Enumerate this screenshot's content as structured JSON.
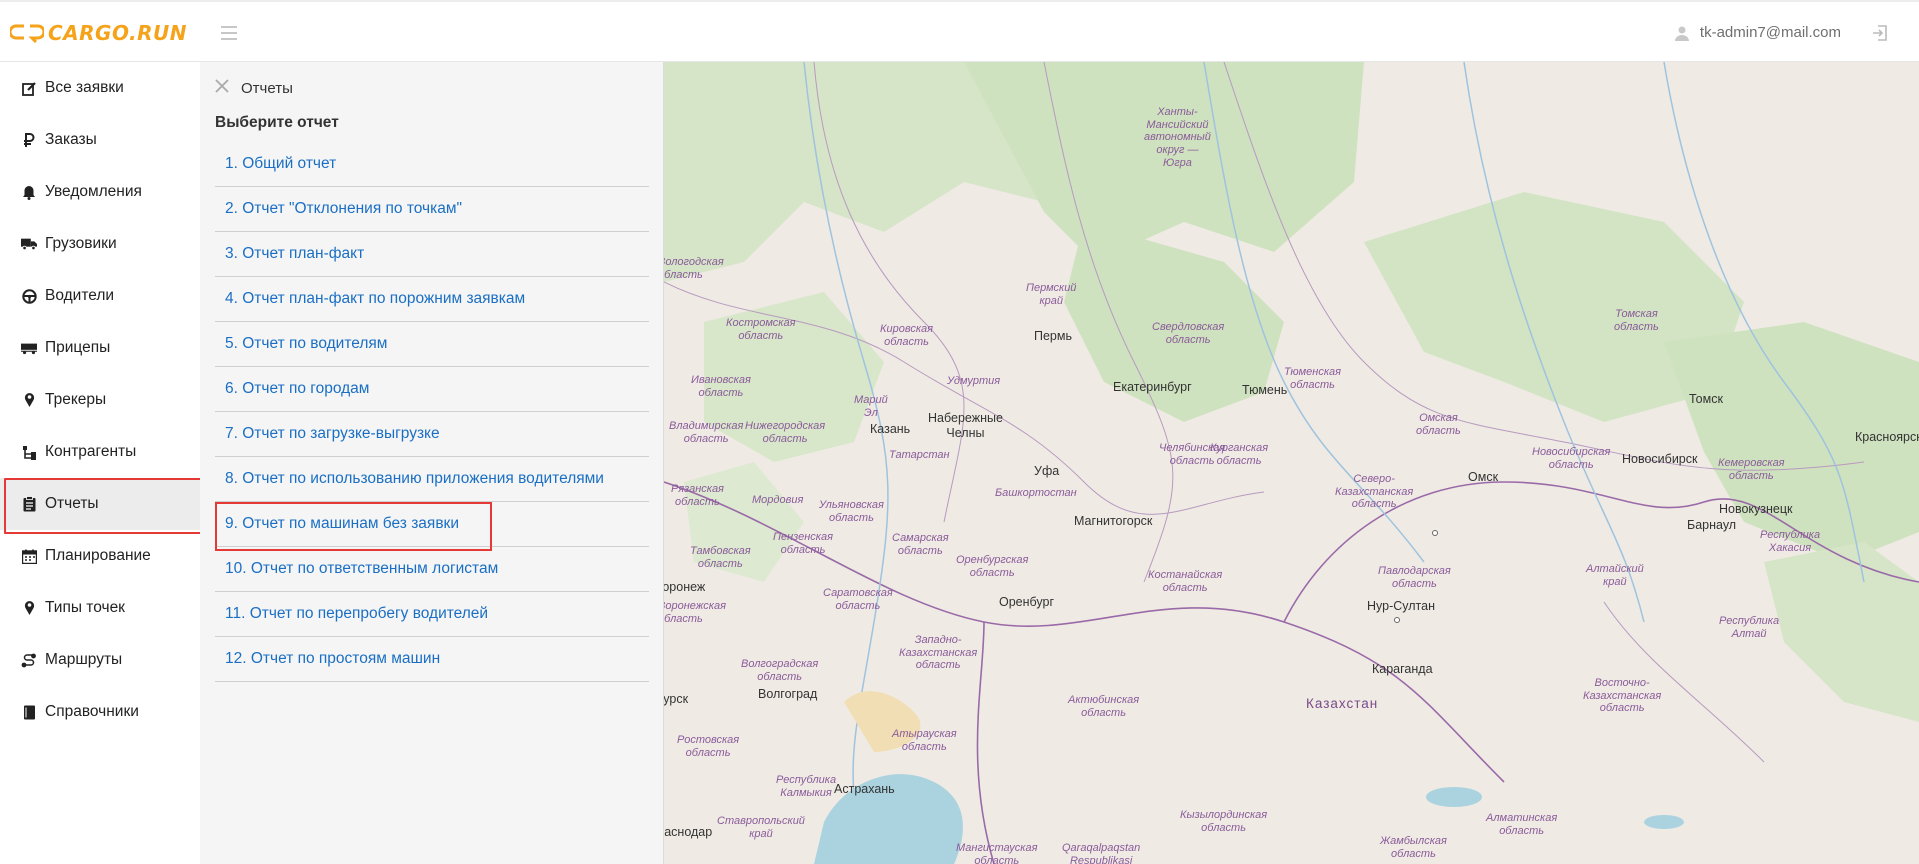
{
  "header": {
    "logo_text": "CARGO.RUN",
    "user_email": "tk-admin7@mail.com",
    "icons": {
      "menu": "hamburger-icon",
      "user": "user-icon",
      "logout": "logout-icon"
    },
    "accent_color": "#f5a31a"
  },
  "sidebar": {
    "items": [
      {
        "label": "Все заявки",
        "icon": "edit-icon"
      },
      {
        "label": "Заказы",
        "icon": "ruble-icon"
      },
      {
        "label": "Уведомления",
        "icon": "bell-icon"
      },
      {
        "label": "Грузовики",
        "icon": "truck-icon"
      },
      {
        "label": "Водители",
        "icon": "steering-wheel-icon"
      },
      {
        "label": "Прицепы",
        "icon": "trailer-icon"
      },
      {
        "label": "Трекеры",
        "icon": "map-pin-icon"
      },
      {
        "label": "Контрагенты",
        "icon": "sitemap-icon"
      },
      {
        "label": "Отчеты",
        "icon": "clipboard-icon",
        "active": true
      },
      {
        "label": "Планирование",
        "icon": "calendar-icon"
      },
      {
        "label": "Типы точек",
        "icon": "map-pin-icon"
      },
      {
        "label": "Маршруты",
        "icon": "route-icon"
      },
      {
        "label": "Справочники",
        "icon": "book-icon"
      }
    ]
  },
  "reports": {
    "title": "Отчеты",
    "subtitle": "Выберите отчет",
    "close_icon": "close-icon",
    "items": [
      "1. Общий отчет",
      "2. Отчет \"Отклонения по точкам\"",
      "3. Отчет план-факт",
      "4. Отчет план-факт по порожним заявкам",
      "5. Отчет по водителям",
      "6. Отчет по городам",
      "7. Отчет по загрузке-выгрузке",
      "8. Отчет по использованию приложения водителями",
      "9. Отчет по машинам без заявки",
      "10. Отчет по ответственным логистам",
      "11. Отчет по перепробегу водителей",
      "12. Отчет по простоям машин"
    ],
    "highlighted_index": 8,
    "link_color": "#1a6fc4",
    "highlight_color": "#e53935"
  },
  "map": {
    "regions": [
      "Ханты-\nМансийский\nавтономный\nокруг —\nЮгра",
      "Вологодская\nобласть",
      "Пермский\nкрай",
      "Костромская\nобласть",
      "Кировская\nобласть",
      "Свердловская\nобласть",
      "Томская\nобласть",
      "Тюменская\nобласть",
      "Удмуртия",
      "Ивановская\nобласть",
      "Марий\nЭл",
      "Омская\nобласть",
      "Владимирская\nобласть",
      "Нижегородская\nобласть",
      "Челябинская\nобласть",
      "Курганская\nобласть",
      "Новосибирская\nобласть",
      "Кемеровская\nобласть",
      "Татарстан",
      "Северо-\nКазахстанская\nобласть",
      "Рязанская\nобласть",
      "Мордовия",
      "Ульяновская\nобласть",
      "Башкортостан",
      "Пензенская\nобласть",
      "Самарская\nобласть",
      "Республика\nХакасия",
      "Тамбовская\nобласть",
      "Оренбургская\nобласть",
      "Костанайская\nобласть",
      "Павлодарская\nобласть",
      "Алтайский\nкрай",
      "Саратовская\nобласть",
      "Воронежская\nобласть",
      "Республика\nАлтай",
      "Западно-\nКазахстанская\nобласть",
      "Волгоградская\nобласть",
      "Актюбинская\nобласть",
      "Восточно-\nКазахстанская\nобласть",
      "Ростовская\nобласть",
      "Атырауская\nобласть",
      "Республика\nКалмыкия",
      "Ставропольский\nкрай",
      "Кызылординская\nобласть",
      "Алматинская\nобласть",
      "Мангистауская\nобласть",
      "Qaraqalpaqstan\nRespublikasi",
      "Жамбылская\nобласть"
    ],
    "cities": [
      "Пермь",
      "Екатеринбург",
      "Тюмень",
      "Томск",
      "Красноярск",
      "Казань",
      "Набережные\nЧелны",
      "Уфа",
      "Омск",
      "Новосибирск",
      "Новокузнецк",
      "Барнаул",
      "Магнитогорск",
      "Нур-Султан",
      "Оренбург",
      "Караганда",
      "Волгоград",
      "Астрахань",
      "Воронеж",
      "Курск",
      "Краснодар"
    ],
    "country": "Казахстан"
  }
}
